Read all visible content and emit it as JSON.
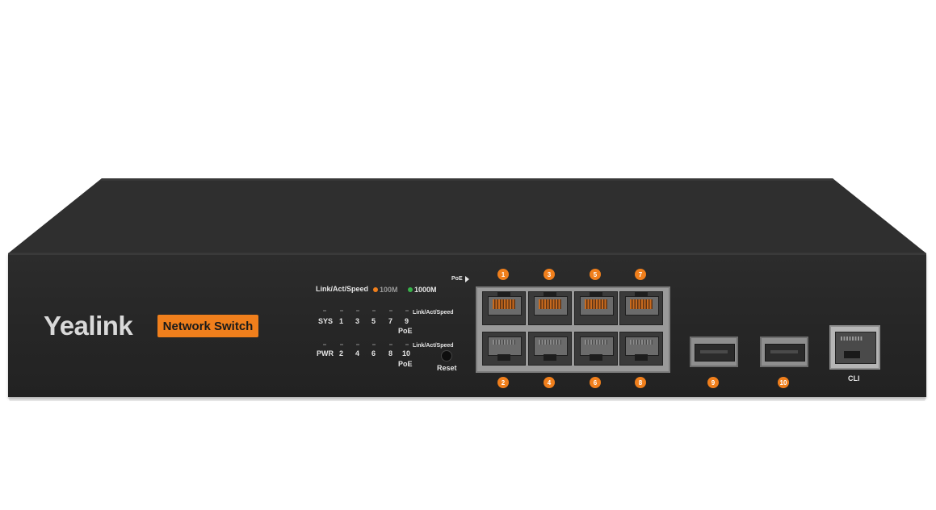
{
  "brand": "Yealink",
  "product_label": "Network Switch",
  "colors": {
    "orange": "#f07f1c",
    "green": "#37b34a",
    "chassis": "#262626"
  },
  "legend": {
    "title": "Link/Act/Speed",
    "speed_100": "100M",
    "speed_1000": "1000M"
  },
  "status_rows": {
    "top": {
      "label": "SYS",
      "ports": [
        "1",
        "3",
        "5",
        "7",
        "9"
      ]
    },
    "bottom": {
      "label": "PWR",
      "ports": [
        "2",
        "4",
        "6",
        "8",
        "10"
      ]
    }
  },
  "side_labels": {
    "link_top": "Link/Act/Speed",
    "poe_top": "PoE",
    "link_bottom": "Link/Act/Speed",
    "poe_bottom": "PoE"
  },
  "reset_label": "Reset",
  "poe_label": "PoE",
  "ports": {
    "top_numbers": [
      "1",
      "3",
      "5",
      "7"
    ],
    "bottom_numbers": [
      "2",
      "4",
      "6",
      "8"
    ],
    "sfp_numbers": [
      "9",
      "10"
    ],
    "console_label": "CLI"
  }
}
